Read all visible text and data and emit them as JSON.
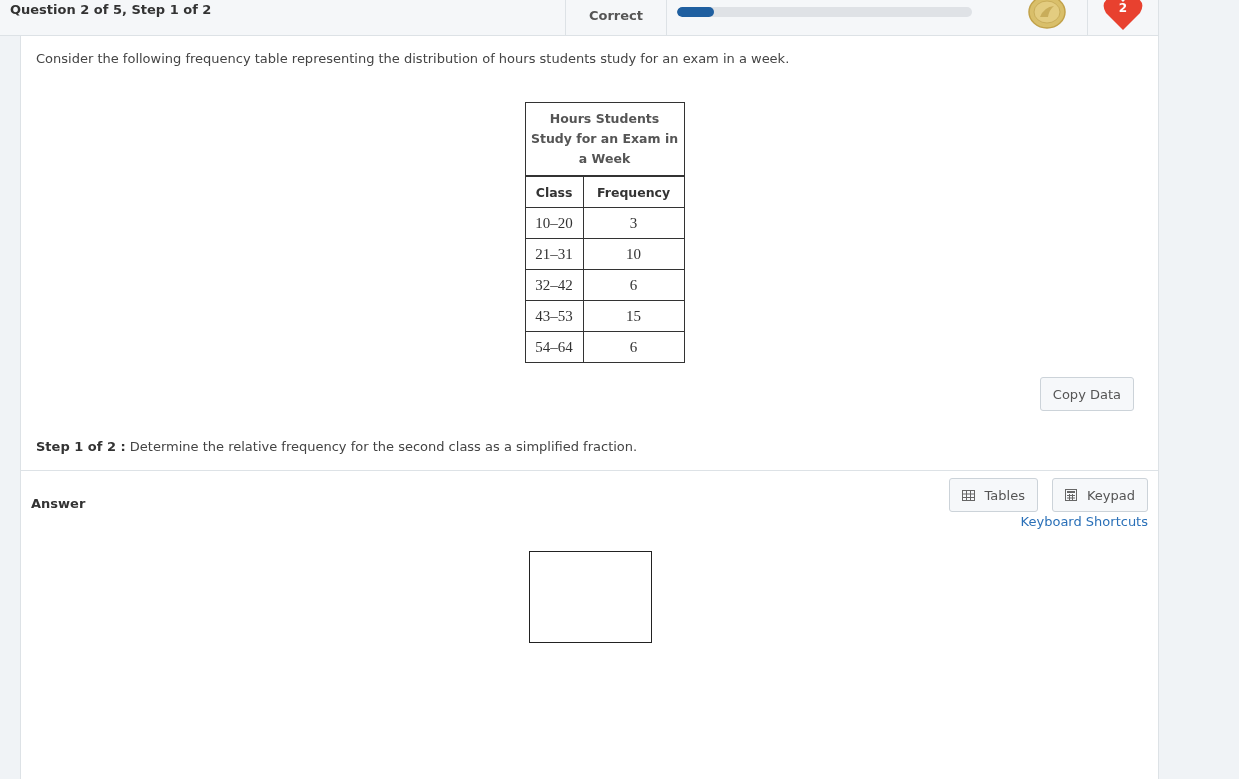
{
  "header": {
    "title": "Question 2 of 5, Step 1 of 2",
    "status": "Correct",
    "progress": {
      "level": 0.125
    },
    "lives": "2"
  },
  "question": {
    "prompt": "Consider the following frequency table representing the distribution of hours students study for an exam in a week.",
    "table": {
      "caption": "Hours Students Study for an Exam in a Week",
      "columns": [
        "Class",
        "Frequency"
      ],
      "rows": [
        [
          "10–20",
          "3"
        ],
        [
          "21–31",
          "10"
        ],
        [
          "32–42",
          "6"
        ],
        [
          "43–53",
          "15"
        ],
        [
          "54–64",
          "6"
        ]
      ]
    },
    "copy_button": "Copy Data",
    "step": "**Step 1 of 2 :** Determine the relative frequency for the second class as a simplified fraction."
  },
  "answer": {
    "label": "Answer",
    "buttons": [
      {
        "kind": "tables",
        "label": "Tables"
      },
      {
        "kind": "keypad",
        "label": "Keypad"
      }
    ],
    "shortcuts_link": "Keyboard Shortcuts"
  }
}
